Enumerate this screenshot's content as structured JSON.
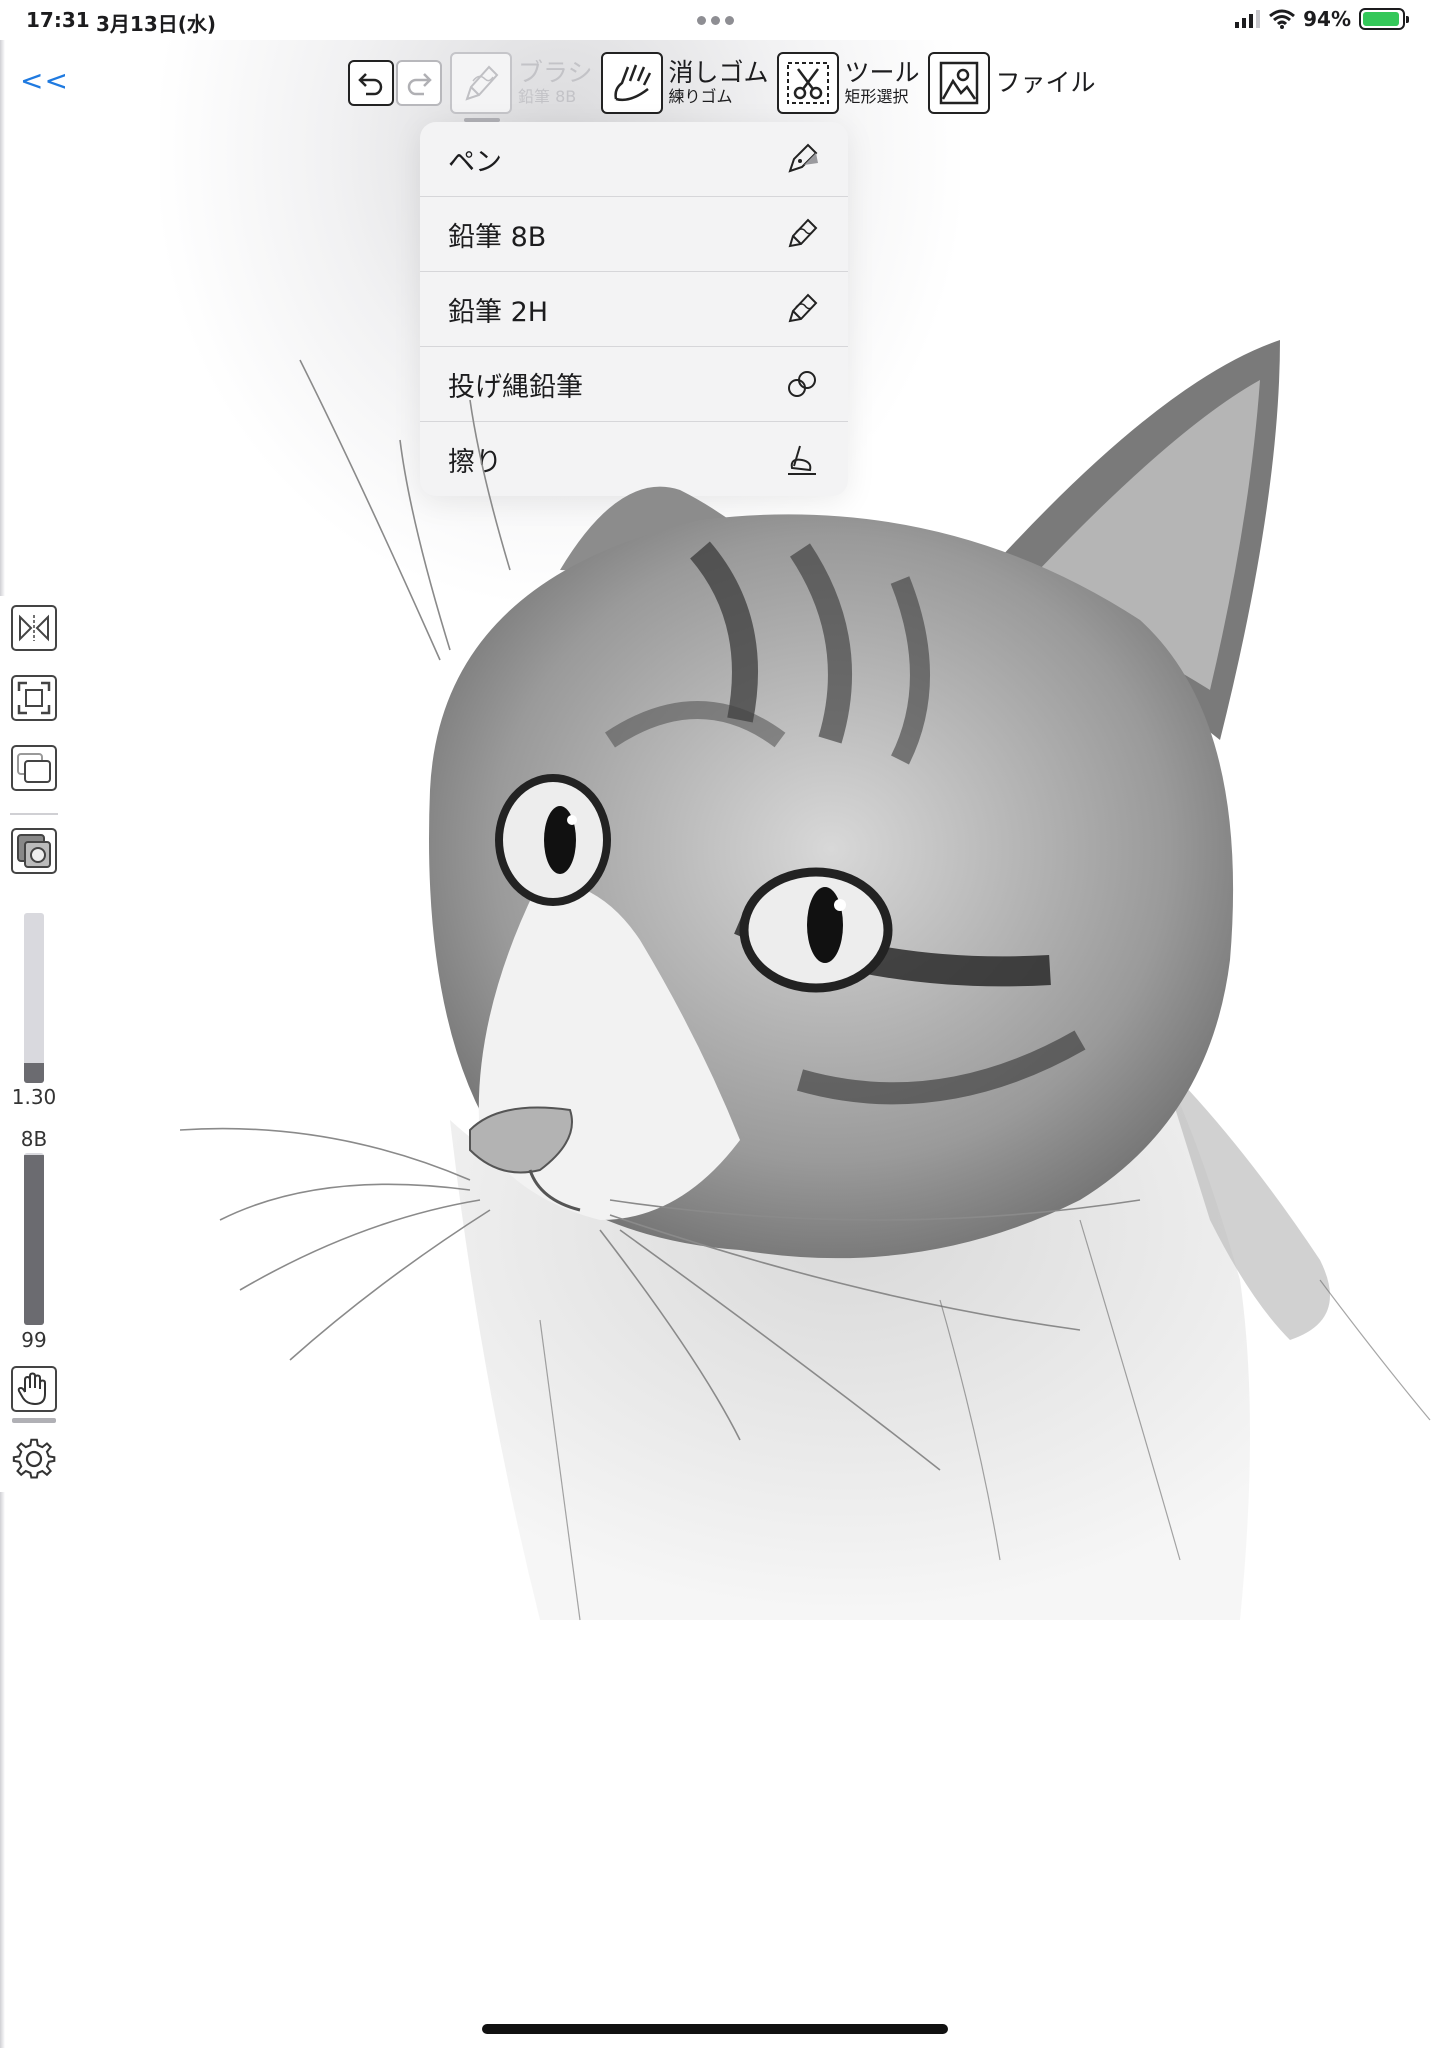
{
  "status_bar": {
    "time": "17:31",
    "date": "3月13日(水)",
    "battery_percent": "94%",
    "battery_level": 0.94
  },
  "back": {
    "label": "<<"
  },
  "toolbar": {
    "brush": {
      "label": "ブラシ",
      "sub": "鉛筆 8B"
    },
    "eraser": {
      "label": "消しゴム",
      "sub": "練りゴム"
    },
    "tool": {
      "label": "ツール",
      "sub": "矩形選択"
    },
    "file": {
      "label": "ファイル"
    }
  },
  "brush_menu": {
    "items": [
      {
        "label": "ペン",
        "icon": "pen-nib-icon"
      },
      {
        "label": "鉛筆 8B",
        "icon": "pencil-icon"
      },
      {
        "label": "鉛筆 2H",
        "icon": "pencil-icon"
      },
      {
        "label": "投げ縄鉛筆",
        "icon": "lasso-icon"
      },
      {
        "label": "擦り",
        "icon": "smudge-icon"
      }
    ]
  },
  "side_panel": {
    "size_value": "1.30",
    "size_level": 0.12,
    "hardness_label": "8B",
    "opacity_value": "99",
    "opacity_level": 0.99
  },
  "colors": {
    "accent": "#1f7ae0",
    "battery": "#34c759"
  }
}
